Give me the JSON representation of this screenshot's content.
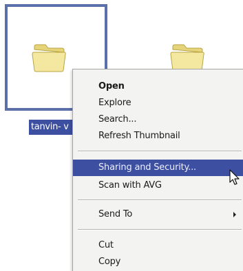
{
  "files": [
    {
      "label": "tanvin- v",
      "selected": true
    },
    {
      "label": "",
      "selected": false
    }
  ],
  "context_menu": {
    "items": [
      {
        "label": "Open",
        "bold": true
      },
      {
        "label": "Explore"
      },
      {
        "label": "Search..."
      },
      {
        "label": "Refresh Thumbnail"
      },
      {
        "label": "Sharing and Security...",
        "highlighted": true
      },
      {
        "label": "Scan with AVG"
      },
      {
        "label": "Send To",
        "submenu": true
      },
      {
        "label": "Cut"
      },
      {
        "label": "Copy"
      }
    ]
  },
  "colors": {
    "selection": "#3d4fa0",
    "frame": "#5b6fa8",
    "menu_bg": "#f3f3f1"
  },
  "icons": [
    "folder-icon",
    "folder-icon",
    "submenu-arrow-icon",
    "mouse-pointer-icon"
  ]
}
